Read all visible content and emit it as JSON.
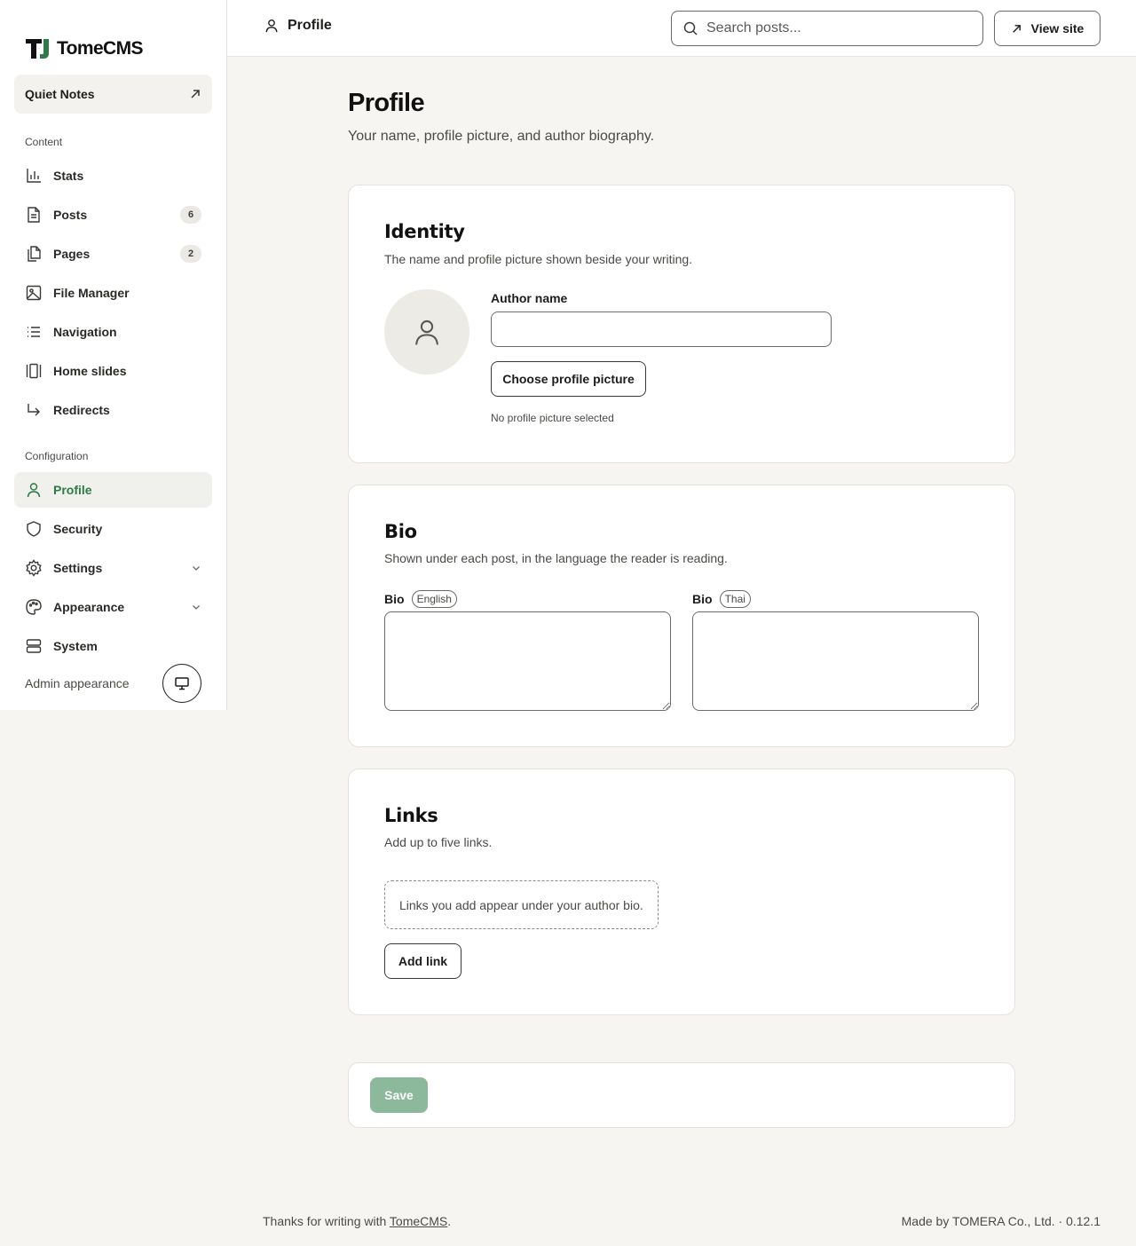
{
  "app": {
    "brand": "TomeCMS"
  },
  "sidebar": {
    "site_name": "Quiet Notes",
    "sections": {
      "content": "Content",
      "configuration": "Configuration"
    },
    "items": [
      {
        "label": "Stats",
        "icon": "bar-chart-icon"
      },
      {
        "label": "Posts",
        "icon": "document-icon",
        "count": "6"
      },
      {
        "label": "Pages",
        "icon": "pages-icon",
        "count": "2"
      },
      {
        "label": "File Manager",
        "icon": "image-icon"
      },
      {
        "label": "Navigation",
        "icon": "list-icon"
      },
      {
        "label": "Home slides",
        "icon": "slides-icon"
      },
      {
        "label": "Redirects",
        "icon": "redirect-arrow-icon"
      },
      {
        "label": "Profile",
        "icon": "user-icon",
        "active": true
      },
      {
        "label": "Security",
        "icon": "shield-icon"
      },
      {
        "label": "Settings",
        "icon": "gear-icon"
      },
      {
        "label": "Appearance",
        "icon": "palette-icon"
      },
      {
        "label": "System",
        "icon": "server-icon"
      }
    ],
    "admin_appearance": "Admin appearance"
  },
  "topbar": {
    "crumb": "Profile",
    "search_placeholder": "Search posts...",
    "view_site": "View site"
  },
  "main": {
    "title": "Profile",
    "subtitle": "Your name, profile picture, and author biography.",
    "identity": {
      "title": "Identity",
      "desc": "The name and profile picture shown beside your writing.",
      "author_label": "Author name",
      "author_value": "",
      "choose_picture": "Choose profile picture",
      "no_picture": "No profile picture selected"
    },
    "bio": {
      "title": "Bio",
      "desc": "Shown under each post, in the language the reader is reading.",
      "label": "Bio",
      "lang_en": "English",
      "lang_th": "Thai"
    },
    "links": {
      "title": "Links",
      "desc": "Add up to five links.",
      "empty": "Links you add appear under your author bio.",
      "add": "Add link"
    },
    "save": "Save"
  },
  "footer": {
    "left_prefix": "Thanks for writing with ",
    "left_link": "TomeCMS",
    "left_suffix": ".",
    "right": "Made by TOMERA Co., Ltd. · 0.12.1"
  },
  "colors": {
    "accent": "#2f7a48",
    "save_disabled": "#8cb89b",
    "background": "#f6f5f1"
  }
}
